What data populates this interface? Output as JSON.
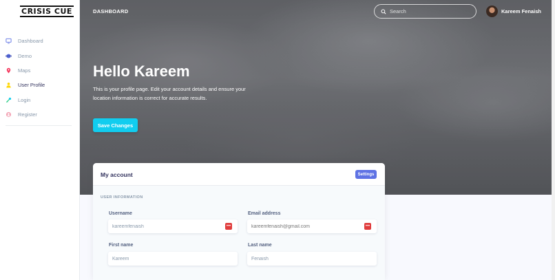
{
  "sidebar": {
    "logo": "CRISIS CUE",
    "items": [
      {
        "label": "Dashboard",
        "icon": "monitor-icon",
        "color": "#5e72e4"
      },
      {
        "label": "Demo",
        "icon": "planet-icon",
        "color": "#5e72e4"
      },
      {
        "label": "Maps",
        "icon": "pin-icon",
        "color": "#f5365c"
      },
      {
        "label": "User Profile",
        "icon": "user-icon",
        "color": "#ffd600"
      },
      {
        "label": "Login",
        "icon": "key-icon",
        "color": "#11cdef"
      },
      {
        "label": "Register",
        "icon": "circle-user-icon",
        "color": "#f3a4b5"
      }
    ]
  },
  "header": {
    "brand": "DASHBOARD",
    "search_placeholder": "Search",
    "user_name": "Kareem Fenaish"
  },
  "hero": {
    "title": "Hello Kareem",
    "description": "This is your profile page. Edit your account details and ensure your location information is correct for accurate results.",
    "save_label": "Save Changes"
  },
  "card": {
    "title": "My account",
    "settings_label": "Settings",
    "section_label": "USER INFORMATION",
    "fields": {
      "username": {
        "label": "Username",
        "value": "kareemfenaish"
      },
      "email": {
        "label": "Email address",
        "placeholder": "kareemfenaish@gmail.com"
      },
      "first_name": {
        "label": "First name",
        "value": "Kareem"
      },
      "last_name": {
        "label": "Last name",
        "value": "Fenaish"
      }
    },
    "badge_text": "•••"
  },
  "colors": {
    "accent": "#5e72e4",
    "cyan": "#11cdef",
    "danger": "#e03c3c"
  }
}
